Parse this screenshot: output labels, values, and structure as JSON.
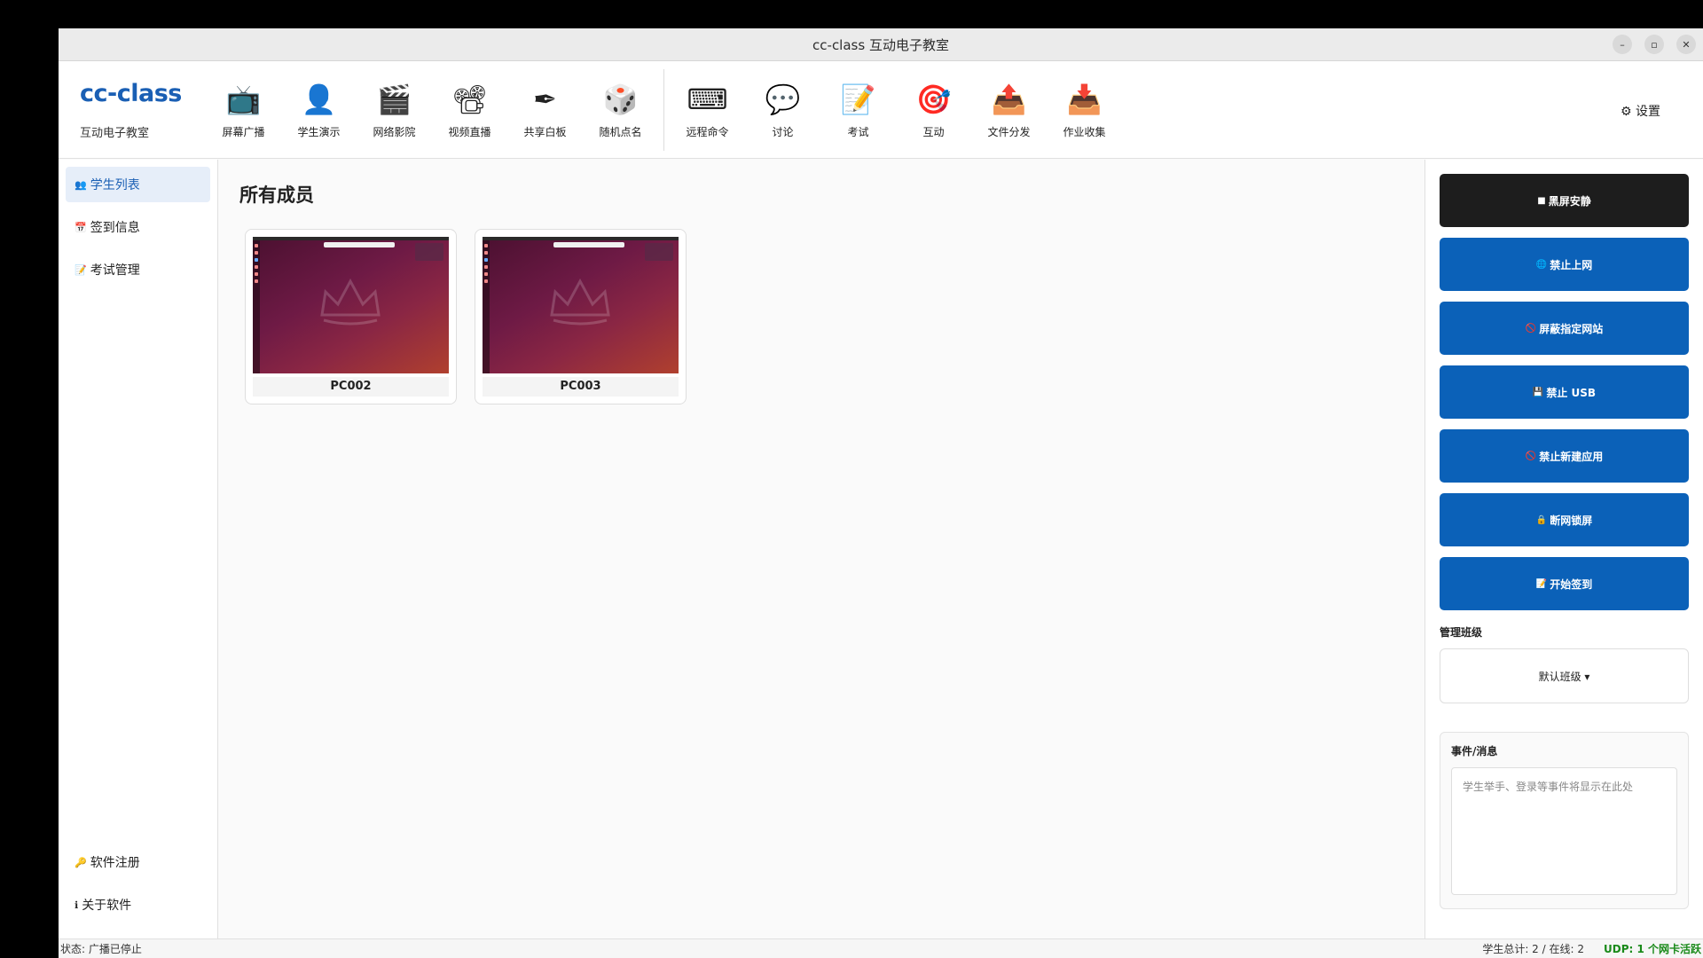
{
  "window": {
    "title": "cc-class 互动电子教室"
  },
  "brand": {
    "name": "cc-class",
    "subtitle": "互动电子教室"
  },
  "toolbar": {
    "group1": [
      {
        "icon": "📺",
        "label": "屏幕广播"
      },
      {
        "icon": "👤",
        "label": "学生演示"
      },
      {
        "icon": "🎬",
        "label": "网络影院"
      },
      {
        "icon": "📽",
        "label": "视频直播"
      },
      {
        "icon": "✒",
        "label": "共享白板"
      },
      {
        "icon": "🎲",
        "label": "随机点名"
      }
    ],
    "group2": [
      {
        "icon": "⌨",
        "label": "远程命令"
      },
      {
        "icon": "💬",
        "label": "讨论"
      },
      {
        "icon": "📝",
        "label": "考试"
      },
      {
        "icon": "🎯",
        "label": "互动"
      },
      {
        "icon": "📤",
        "label": "文件分发"
      },
      {
        "icon": "📥",
        "label": "作业收集"
      }
    ],
    "settings": "⚙ 设置"
  },
  "sidebar": {
    "items": [
      {
        "icon": "👥",
        "label": "学生列表"
      },
      {
        "icon": "📅",
        "label": "签到信息"
      },
      {
        "icon": "📝",
        "label": "考试管理"
      }
    ],
    "bottom": [
      {
        "icon": "🔑",
        "label": "软件注册"
      },
      {
        "icon": "ℹ",
        "label": "关于软件"
      }
    ]
  },
  "main": {
    "heading": "所有成员",
    "students": [
      {
        "name": "PC002"
      },
      {
        "name": "PC003"
      }
    ]
  },
  "actions": [
    {
      "icon": "■",
      "label": "黑屏安静"
    },
    {
      "icon": "🌐",
      "label": "禁止上网"
    },
    {
      "icon": "🚫",
      "label": "屏蔽指定网站"
    },
    {
      "icon": "💾",
      "label": "禁止 USB"
    },
    {
      "icon": "🚫",
      "label": "禁止新建应用"
    },
    {
      "icon": "🔒",
      "label": "断网锁屏"
    },
    {
      "icon": "📝",
      "label": "开始签到"
    }
  ],
  "class_manage": {
    "label": "管理班级",
    "selected": "默认班级 ▾"
  },
  "events": {
    "label": "事件/消息",
    "placeholder": "学生举手、登录等事件将显示在此处"
  },
  "status": {
    "left": "状态: 广播已停止",
    "counts": "学生总计: 2 / 在线: 2",
    "udp": "UDP: 1 个网卡活跃"
  },
  "colors": {
    "accent": "#0b61b8",
    "dark_button": "#1d1d1d",
    "udp_ok": "#1a8a1a"
  }
}
